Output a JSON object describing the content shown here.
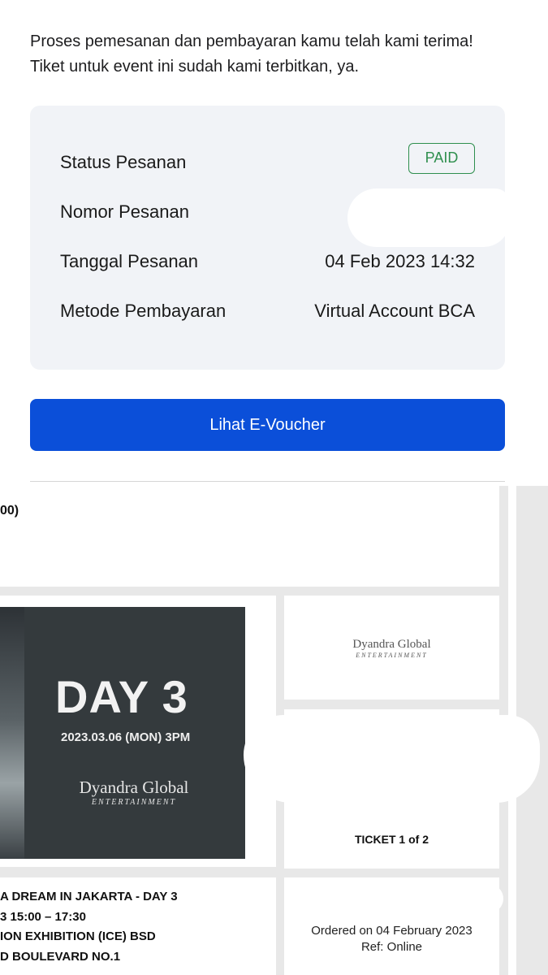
{
  "confirmation": {
    "message": "Proses pemesanan dan pembayaran kamu telah kami terima! Tiket untuk event ini sudah kami terbitkan, ya."
  },
  "order_summary": {
    "status_label": "Status Pesanan",
    "status_value": "PAID",
    "status_color": "#2f8f4e",
    "number_label": "Nomor Pesanan",
    "date_label": "Tanggal Pesanan",
    "date_value": "04 Feb 2023 14:32",
    "method_label": "Metode Pembayaran",
    "method_value": "Virtual Account BCA"
  },
  "actions": {
    "voucher_label": "Lihat E-Voucher",
    "accent_color": "#0b4fd9"
  },
  "ticket": {
    "header_fragment": "00)",
    "poster": {
      "day": "DAY 3",
      "date": "2023.03.06 (MON) 3PM",
      "brand_name": "Dyandra Global",
      "brand_sub": "ENTERTAINMENT"
    },
    "organizer": {
      "brand_name": "Dyandra Global",
      "brand_sub": "ENTERTAINMENT"
    },
    "ticket_count": "TICKET 1 of 2",
    "event_lines": [
      "A DREAM IN JAKARTA - DAY 3",
      "3 15:00 – 17:30",
      "ION EXHIBITION (ICE) BSD",
      "D BOULEVARD NO.1"
    ],
    "ordered_on": "Ordered on 04 February 2023",
    "ref": "Ref: Online"
  }
}
